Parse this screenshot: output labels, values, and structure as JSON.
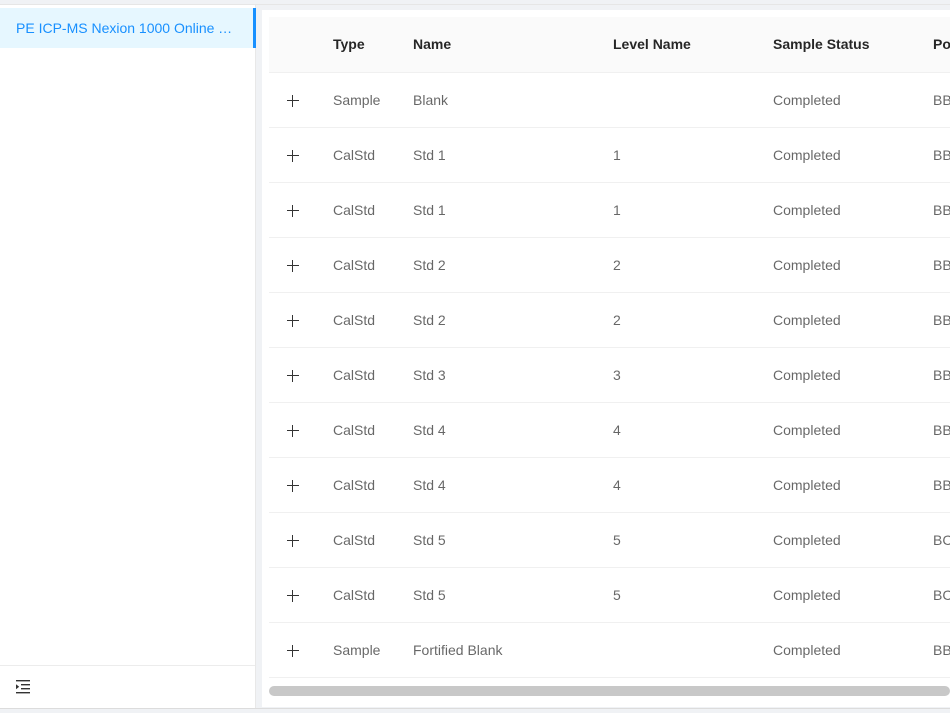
{
  "sidebar": {
    "items": [
      {
        "label": "PE ICP-MS Nexion 1000 Online Te..."
      }
    ],
    "collapse_icon": "menu-fold-icon"
  },
  "table": {
    "columns": [
      "Type",
      "Name",
      "Level Name",
      "Sample Status",
      "Po"
    ],
    "rows": [
      {
        "type": "Sample",
        "name": "Blank",
        "level": "",
        "status": "Completed",
        "pos": "BB"
      },
      {
        "type": "CalStd",
        "name": "Std 1",
        "level": "1",
        "status": "Completed",
        "pos": "BB"
      },
      {
        "type": "CalStd",
        "name": "Std 1",
        "level": "1",
        "status": "Completed",
        "pos": "BB"
      },
      {
        "type": "CalStd",
        "name": "Std 2",
        "level": "2",
        "status": "Completed",
        "pos": "BB"
      },
      {
        "type": "CalStd",
        "name": "Std 2",
        "level": "2",
        "status": "Completed",
        "pos": "BB"
      },
      {
        "type": "CalStd",
        "name": "Std 3",
        "level": "3",
        "status": "Completed",
        "pos": "BB"
      },
      {
        "type": "CalStd",
        "name": "Std 4",
        "level": "4",
        "status": "Completed",
        "pos": "BB"
      },
      {
        "type": "CalStd",
        "name": "Std 4",
        "level": "4",
        "status": "Completed",
        "pos": "BB"
      },
      {
        "type": "CalStd",
        "name": "Std 5",
        "level": "5",
        "status": "Completed",
        "pos": "BC"
      },
      {
        "type": "CalStd",
        "name": "Std 5",
        "level": "5",
        "status": "Completed",
        "pos": "BC"
      },
      {
        "type": "Sample",
        "name": "Fortified Blank",
        "level": "",
        "status": "Completed",
        "pos": "BB"
      }
    ],
    "expand_icon": "plus-icon"
  },
  "colors": {
    "accent": "#1890ff",
    "selected_bg": "#e6f7ff",
    "header_bg": "#fafafa",
    "page_bg": "#f0f2f5"
  }
}
